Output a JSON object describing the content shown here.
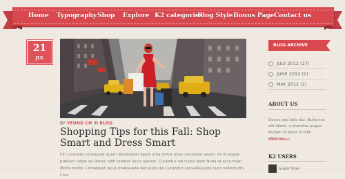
{
  "nav": {
    "items": [
      "Home",
      "Typography",
      "Shop",
      "Explore",
      "K2 categories",
      "Blog Style",
      "Bonus Page",
      "Contact us"
    ]
  },
  "post": {
    "day": "21",
    "month": "JUL",
    "byline_prefix": "BY",
    "author": "YEUNG CH",
    "byline_sep": "IN",
    "category": "BLOG",
    "title": "Shopping Tips for this Fall: Shop Smart and Dress Smart",
    "excerpt": "Elit convallis consequat quam Vestibulum ligula urna tortor urna commodo ipsum. Ut id augue pretium turpis sit Donec nibh tempor lacus laoreet. Curabitur vel turpis Nam Nulla at accumsan. Morbi morbi. Consequat lacus malesuada sed justo dui Curabitur convallis justo nunc sollicitudin. Cras"
  },
  "sidebar": {
    "archive_title": "BLOG ARCHIVE",
    "archive": [
      "JULY 2012 (27)",
      "JUNE 2012 (1)",
      "MAY 2012 (1)"
    ],
    "about_title": "ABOUT US",
    "about_text": "Donec sed odio dui. Nulla nec elit libero, a pharetra augue. Nullam id dolor id nibh ultricies.",
    "more_label": "More detail",
    "users_title": "K2 USERS",
    "user_name": "Super User"
  },
  "colors": {
    "accent": "#d9484e",
    "background": "#f1ebe3"
  }
}
